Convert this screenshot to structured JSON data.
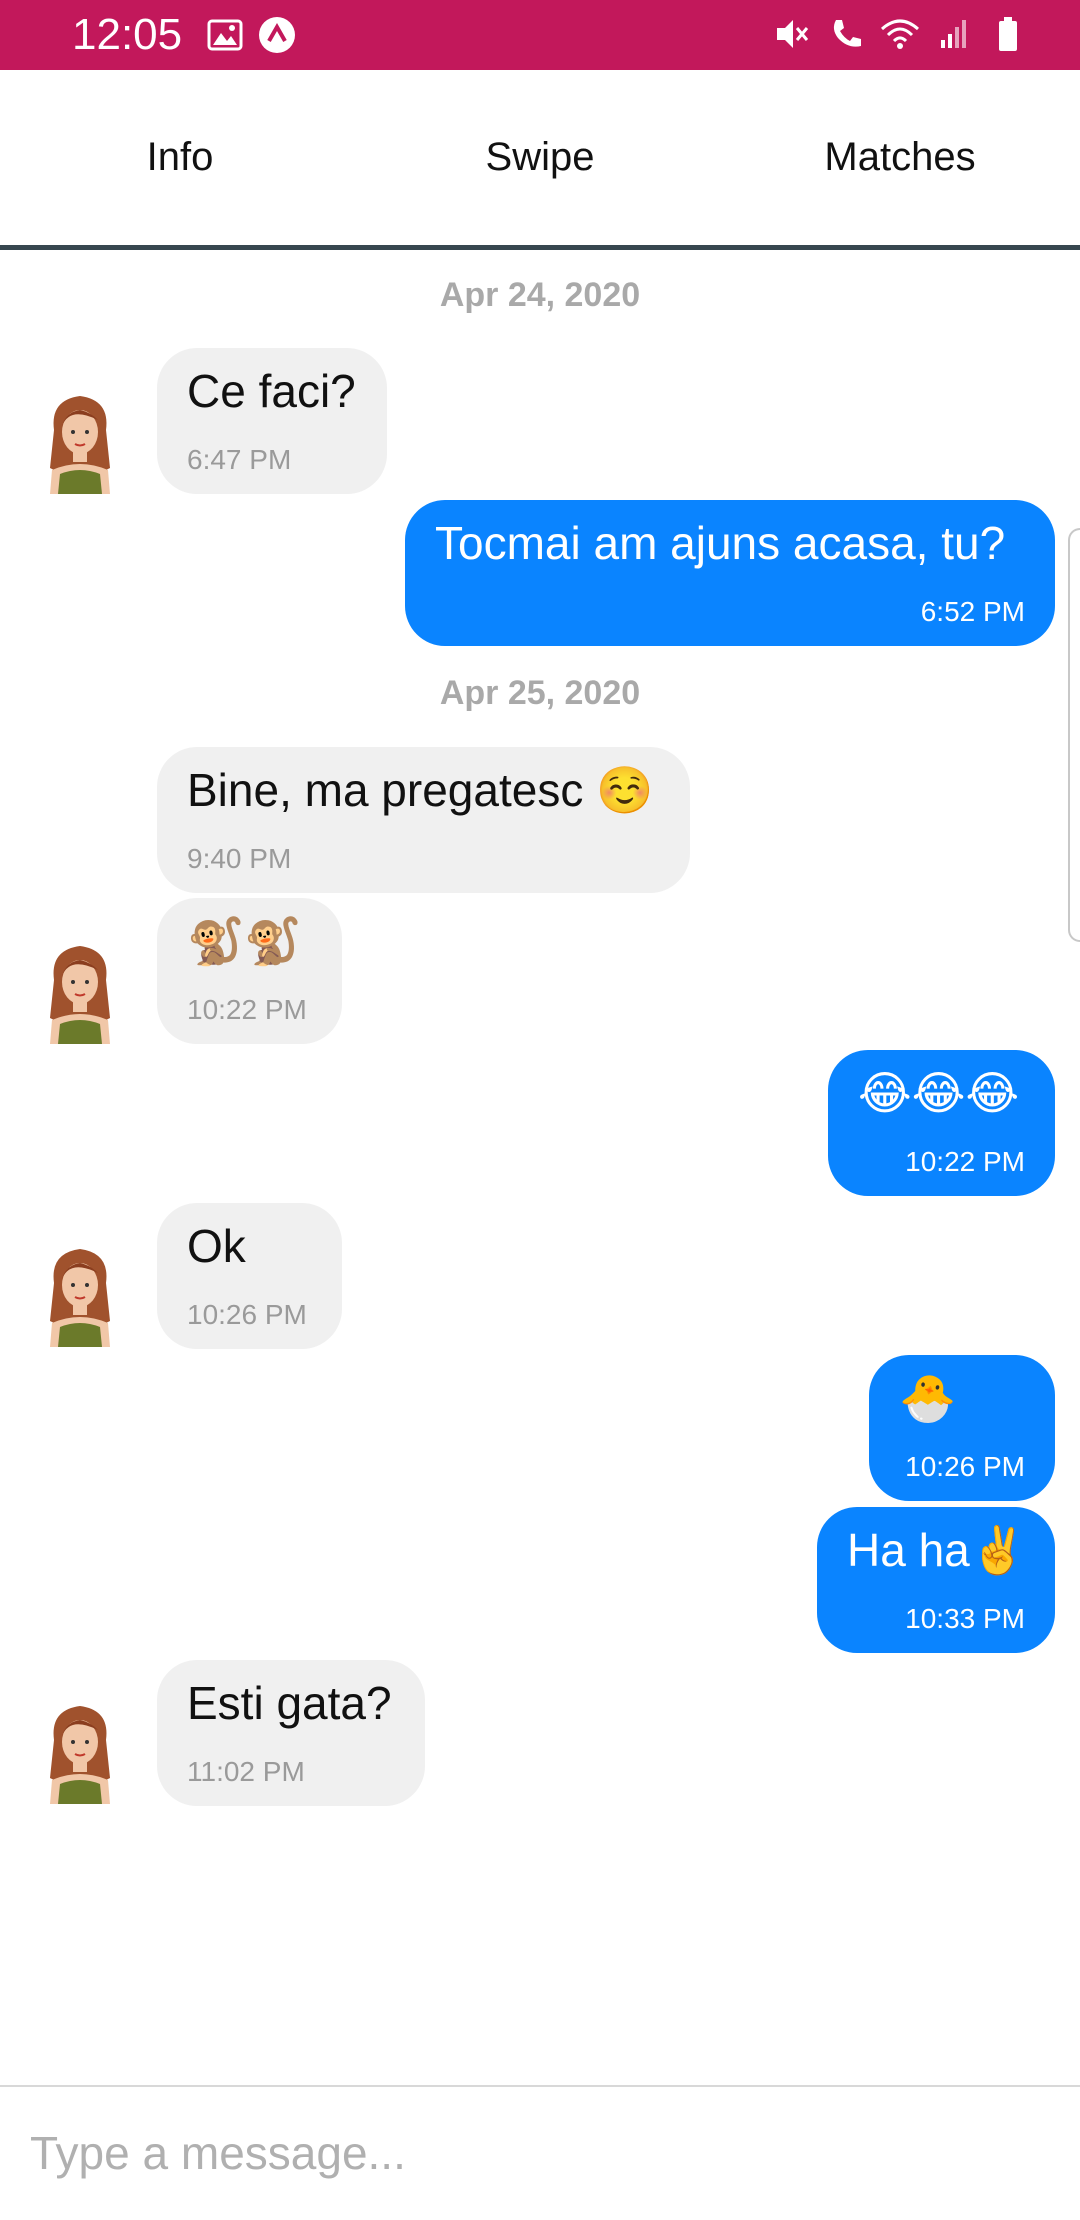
{
  "status_bar": {
    "time": "12:05",
    "left_icons": [
      "image-icon",
      "app-circle-icon"
    ],
    "right_icons": [
      "mute-icon",
      "wifi-calling-icon",
      "wifi-icon",
      "signal-icon",
      "battery-icon"
    ],
    "color": "#c2185b"
  },
  "tabs": [
    {
      "label": "Info"
    },
    {
      "label": "Swipe"
    },
    {
      "label": "Matches",
      "active": true
    }
  ],
  "chat": {
    "dates": [
      "Apr 24, 2020",
      "Apr 25, 2020"
    ],
    "messages": [
      {
        "direction": "in",
        "text": "Ce faci?",
        "time": "6:47 PM"
      },
      {
        "direction": "out",
        "text": "Tocmai am ajuns acasa, tu?",
        "time": "6:52 PM"
      },
      {
        "direction": "in",
        "text": "Bine, ma pregatesc ☺️",
        "time": "9:40 PM"
      },
      {
        "direction": "in",
        "text": "🐒🐒",
        "time": "10:22 PM"
      },
      {
        "direction": "out",
        "text": "😂😂😂",
        "time": "10:22 PM"
      },
      {
        "direction": "in",
        "text": "Ok",
        "time": "10:26 PM"
      },
      {
        "direction": "out",
        "text": "🐣",
        "time": "10:26 PM"
      },
      {
        "direction": "out",
        "text": "Ha ha✌️",
        "time": "10:33 PM"
      },
      {
        "direction": "in",
        "text": "Esti gata?",
        "time": "11:02 PM"
      }
    ],
    "incoming_color": "#f0f0f0",
    "outgoing_color": "#0a84ff"
  },
  "composer": {
    "placeholder": "Type a message..."
  }
}
